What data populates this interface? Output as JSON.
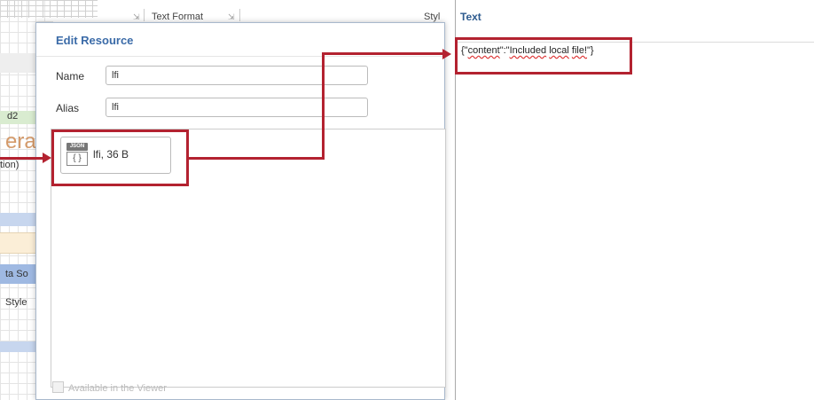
{
  "toolbar": {
    "text_format_label": "Text Format",
    "style_label": "Styl"
  },
  "background_sheet": {
    "row_a": "d2",
    "row_b": "era",
    "row_c": "tion)",
    "row_d": "ta So",
    "row_e": "Style"
  },
  "dialog": {
    "title": "Edit Resource",
    "name_label": "Name",
    "name_value": "lfi",
    "alias_label": "Alias",
    "alias_value": "lfi",
    "resource": {
      "type_badge": "JSON",
      "icon_glyph": "{ }",
      "label": "lfi, 36 B"
    },
    "available_in_viewer_label": "Available in the Viewer"
  },
  "text_panel": {
    "title": "Text",
    "content_prefix": "{\"",
    "content_key": "content",
    "content_mid": "\":\"",
    "content_word1": "Included",
    "content_word2": "local",
    "content_word3": "file!",
    "content_suffix": "\"}"
  },
  "colors": {
    "callout": "#b32230",
    "title_blue": "#3b6ba8"
  }
}
